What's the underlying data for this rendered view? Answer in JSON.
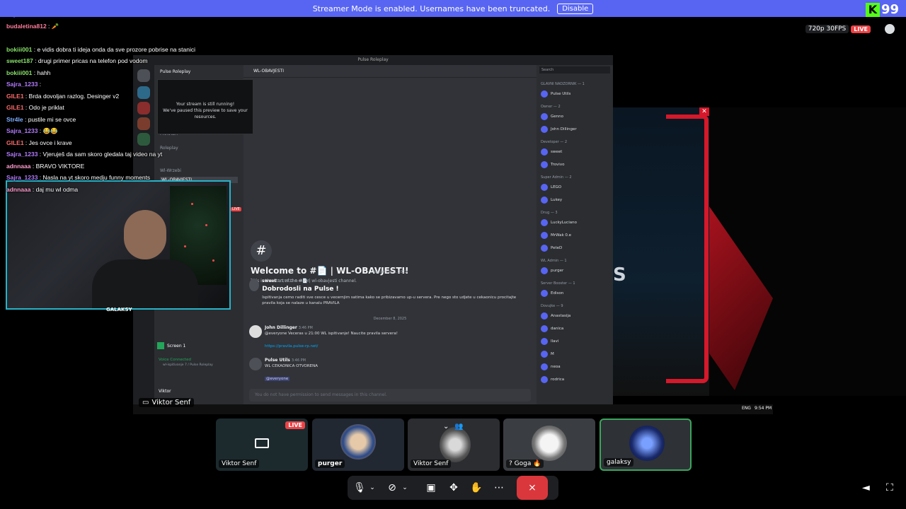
{
  "banner": {
    "text": "Streamer Mode is enabled. Usernames have been truncated.",
    "disable_label": "Disable"
  },
  "kick": {
    "k": "K",
    "count": "99"
  },
  "stream_info": {
    "quality": "720p 30FPS",
    "live": "LIVE"
  },
  "chat_lines": [
    {
      "user": "Sajra_1233",
      "sep": " : ",
      "text": "",
      "color": "#b47cff"
    },
    {
      "user": "budaletina812",
      "sep": " : ",
      "text": "🥕",
      "color": "#ff7d9c"
    },
    {
      "user": "",
      "sep": "",
      "text": "",
      "color": "#ffffff"
    },
    {
      "user": "bokiii001",
      "sep": " : ",
      "text": "e vidis dobra ti ideja onda da sve prozore pobrise na stanici",
      "color": "#88e26a"
    },
    {
      "user": "sweet187",
      "sep": " : ",
      "text": "drugi primer pricas na telefon pod vodom",
      "color": "#88e26a"
    },
    {
      "user": "bokiii001",
      "sep": " : ",
      "text": "hahh",
      "color": "#88e26a"
    },
    {
      "user": "Sajra_1233",
      "sep": " : ",
      "text": "",
      "color": "#b47cff"
    },
    {
      "user": "GILE1",
      "sep": " : ",
      "text": "Brda dovoljan razlog. Desinger v2",
      "color": "#ff6b6b"
    },
    {
      "user": "GILE1",
      "sep": " : ",
      "text": "Odo je priklat",
      "color": "#ff6b6b"
    },
    {
      "user": "Str4le",
      "sep": " : ",
      "text": "pustile mi se ovce",
      "color": "#7fb0ff"
    },
    {
      "user": "Sajra_1233",
      "sep": " : ",
      "text": "😂😂",
      "color": "#b47cff"
    },
    {
      "user": "GILE1",
      "sep": " : ",
      "text": "Jes ovce i krave",
      "color": "#ff6b6b"
    },
    {
      "user": "Sajra_1233",
      "sep": " : ",
      "text": "Vjeruješ da sam skoro gledala taj video na yt",
      "color": "#b47cff"
    },
    {
      "user": "adnnaaa",
      "sep": " : ",
      "text": "BRAVO VIKTORE",
      "color": "#ff9ecf"
    },
    {
      "user": "Sajra_1233",
      "sep": " : ",
      "text": "Nasla na yt skoro medju funny moments",
      "color": "#b47cff"
    },
    {
      "user": "adnnaaa",
      "sep": " : ",
      "text": "daj mu wl odma",
      "color": "#ff9ecf"
    }
  ],
  "discord": {
    "window_title": "Pulse Roleplay",
    "server_name": "Pulse Roleplay",
    "channel_name": "WL-OBAVJESTI",
    "search_placeholder": "Search",
    "popup_line1": "Your stream is still running!",
    "popup_line2": "We've paused this preview to save your resources.",
    "channels": [
      "PRAVILA",
      "Roleplay",
      "Wl-Wrzebi",
      "WL-OBAVJESTI"
    ],
    "welcome_title": "Welcome to #📄 | WL-OBAVJESTI!",
    "welcome_sub": "This is the start of the #📄 | wl-obavjesti channel.",
    "date1": "September 3, 2022",
    "date2": "December 8, 2025",
    "messages": [
      {
        "user": "sweet",
        "time": "9/3/2022 6:44 PM",
        "title": "Dobrodosli na Pulse !",
        "body": "Ispitivanja cemo raditi sve cesce u vecernjim satima kako se pribizavamo up-u servera. Pre nego sto udjete u cekaonicu procitajte pravila koja se nalaze u kanalu PRAVILA"
      },
      {
        "user": "John Dillinger",
        "time": "3:46 PM",
        "title": "",
        "body": "@everyone Veceras u 21:00 WL ispitivanje! Naucite pravila servera!"
      },
      {
        "user": "",
        "time": "",
        "title": "",
        "body": "https://pravila.pulse-rp.net/"
      },
      {
        "user": "Pulse Utils",
        "time": "3:46 PM",
        "title": "",
        "body": "WL CEKAONICA OTVORENA"
      },
      {
        "user": "",
        "time": "",
        "title": "",
        "body": "@everyone"
      }
    ],
    "compose_placeholder": "You do not have permission to send messages in this channel.",
    "voice_status": "Voice Connected",
    "voice_channel": "wl-ispitivanje 7 / Pulse Roleplay",
    "screen_label": "Screen 1",
    "self_user": "Viktor",
    "member_groups": [
      {
        "title": "GLAVNI NADZORNIK — 1",
        "members": [
          "Pulse Utils"
        ]
      },
      {
        "title": "Owner — 2",
        "members": [
          "Genno",
          "John Dillinger"
        ]
      },
      {
        "title": "Developer — 2",
        "members": [
          "sweet",
          "Trovivo"
        ]
      },
      {
        "title": "Super Admin — 2",
        "members": [
          "LEGO",
          "Lukey"
        ]
      },
      {
        "title": "Drug — 3",
        "members": [
          "LuckyLuciano",
          "MrWak 0.e",
          "PeteD"
        ]
      },
      {
        "title": "WL Admin — 1",
        "members": [
          "purger"
        ]
      },
      {
        "title": "Server Booster — 1",
        "members": [
          "Edison"
        ]
      },
      {
        "title": "Dovujke — 9",
        "members": [
          "Anastasija",
          "danica",
          "Ilavi",
          "M",
          "neoa",
          "rodrica"
        ]
      }
    ],
    "taskbar_lang": "ENG",
    "taskbar_time": "9:54 PM"
  },
  "webcam": {
    "logo": "GALAKSY",
    "live": "LIVE"
  },
  "game": {
    "text": "S"
  },
  "stream_label": "Viktor Senf",
  "tiles": [
    {
      "label": "Viktor Senf",
      "live": "LIVE"
    },
    {
      "label": "purger",
      "live": ""
    },
    {
      "label": "Viktor Senf",
      "live": ""
    },
    {
      "label": "? Goga 🔥",
      "live": ""
    },
    {
      "label": "galaksy",
      "live": ""
    }
  ],
  "colors": {
    "blurple": "#5865f2",
    "live_red": "#ed4245",
    "leave_red": "#da373c",
    "accent_cyan": "#26b4c9",
    "game_red": "#d5182a"
  }
}
